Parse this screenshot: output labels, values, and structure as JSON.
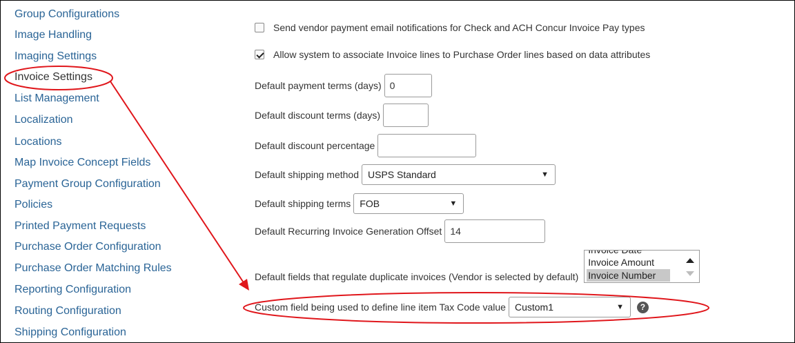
{
  "sidebar": {
    "items": [
      {
        "label": "Group Configurations"
      },
      {
        "label": "Image Handling"
      },
      {
        "label": "Imaging Settings"
      },
      {
        "label": "Invoice Settings"
      },
      {
        "label": "List Management"
      },
      {
        "label": "Localization"
      },
      {
        "label": "Locations"
      },
      {
        "label": "Map Invoice Concept Fields"
      },
      {
        "label": "Payment Group Configuration"
      },
      {
        "label": "Policies"
      },
      {
        "label": "Printed Payment Requests"
      },
      {
        "label": "Purchase Order Configuration"
      },
      {
        "label": "Purchase Order Matching Rules"
      },
      {
        "label": "Reporting Configuration"
      },
      {
        "label": "Routing Configuration"
      },
      {
        "label": "Shipping Configuration"
      }
    ],
    "active": "Invoice Settings"
  },
  "settings": {
    "vendor_email": {
      "label": "Send vendor payment email notifications for Check and ACH Concur Invoice Pay types",
      "checked": false
    },
    "associate_lines": {
      "label": "Allow system to associate Invoice lines to Purchase Order lines based on data attributes",
      "checked": true
    },
    "payment_terms": {
      "label": "Default payment terms (days)",
      "value": "0"
    },
    "discount_terms": {
      "label": "Default discount terms (days)",
      "value": ""
    },
    "discount_percentage": {
      "label": "Default discount percentage",
      "value": ""
    },
    "shipping_method": {
      "label": "Default shipping method",
      "value": "USPS Standard"
    },
    "shipping_terms": {
      "label": "Default shipping terms",
      "value": "FOB"
    },
    "recurring_offset": {
      "label": "Default Recurring Invoice Generation Offset",
      "value": "14"
    },
    "duplicate_fields": {
      "label": "Default fields that regulate duplicate invoices (Vendor is selected by default)",
      "options": [
        "Invoice Date",
        "Invoice Amount",
        "Invoice Number"
      ],
      "selected": "Invoice Number"
    },
    "tax_code_field": {
      "label": "Custom field being used to define line item Tax Code value",
      "value": "Custom1"
    }
  },
  "colors": {
    "link": "#2a6496",
    "annotation": "#e0161b"
  }
}
